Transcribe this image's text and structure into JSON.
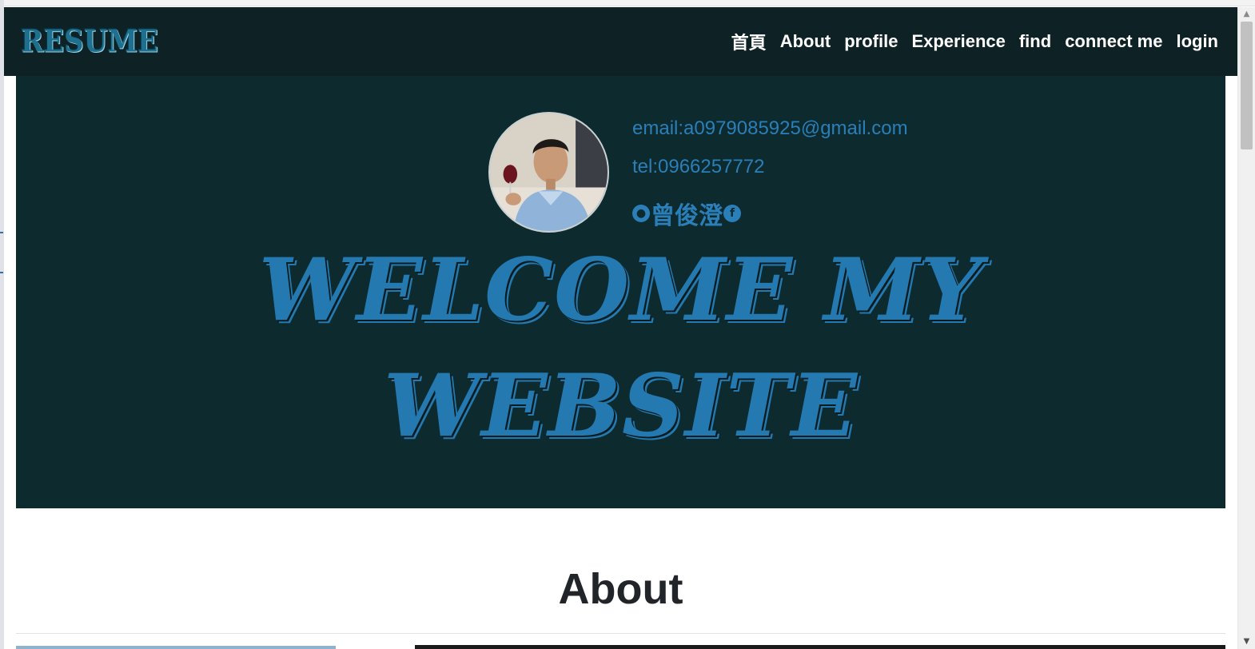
{
  "navbar": {
    "brand": "RESUME",
    "links": [
      "首頁",
      "About",
      "profile",
      "Experience",
      "find",
      "connect me",
      "login"
    ]
  },
  "hero": {
    "avatar_icon": "profile-photo",
    "email": "email:a0979085925@gmail.com",
    "tel": "tel:0966257772",
    "social": {
      "github_icon": "github-icon",
      "name": "曾俊澄",
      "facebook_icon": "facebook-icon"
    },
    "welcome_line1": "WELCOME MY",
    "welcome_line2": "WEBSITE"
  },
  "about": {
    "title": "About"
  },
  "colors": {
    "navbar_bg": "#0e2226",
    "hero_bg": "#0d2a2f",
    "accent": "#2379b0"
  },
  "scrollbar": {
    "up_icon": "chevron-up-icon",
    "down_icon": "chevron-down-icon"
  }
}
